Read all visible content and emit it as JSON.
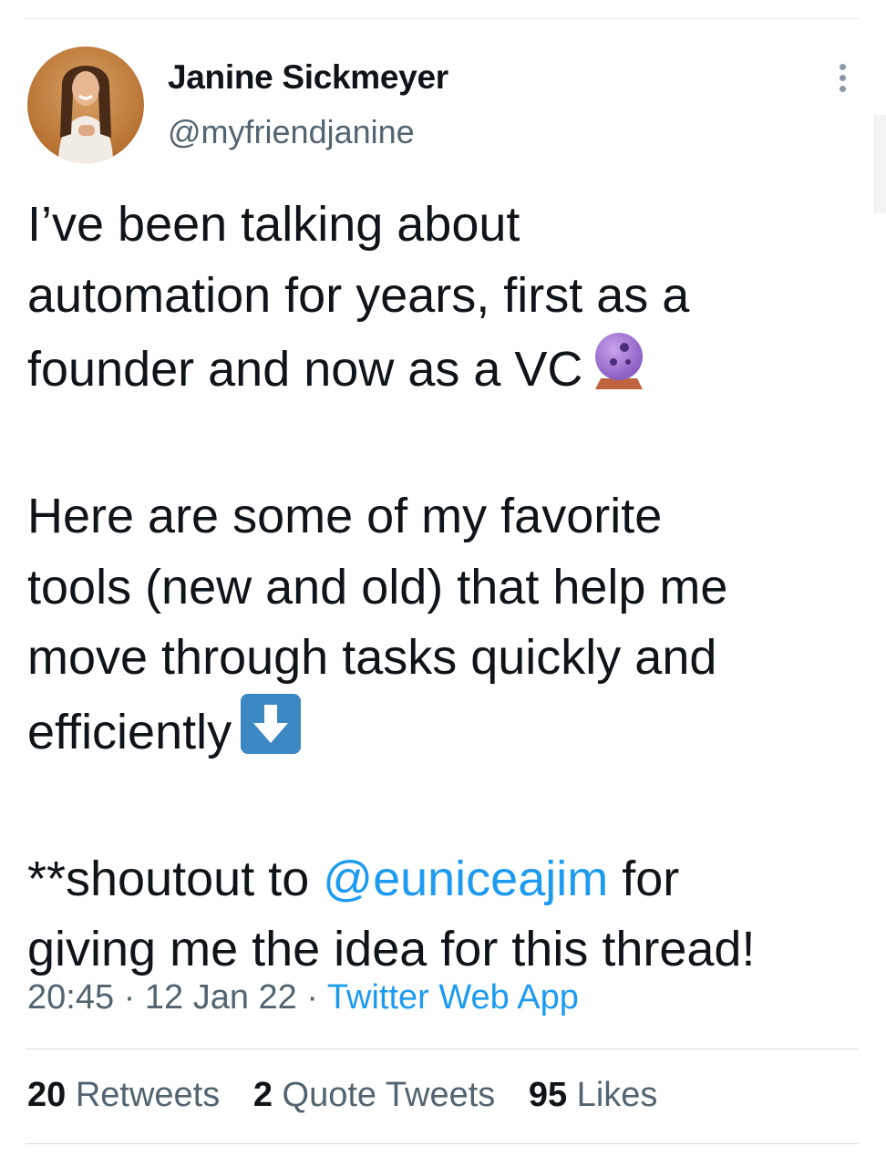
{
  "author": {
    "name": "Janine Sickmeyer",
    "handle": "@myfriendjanine"
  },
  "tweet": {
    "line1": "I’ve been talking about",
    "line2": "automation for years, first as a",
    "line3": "founder and now as a VC",
    "line3_emoji": "crystal-ball-icon",
    "line4": "Here are some of my favorite",
    "line5": "tools (new and old) that help me",
    "line6": "move through tasks quickly and",
    "line7": "efficiently",
    "line7_emoji": "down-arrow-icon",
    "line8_prefix": "**shoutout to ",
    "mention": "@euniceajim",
    "line8_suffix": " for",
    "line9": "giving me the idea for this thread!"
  },
  "meta": {
    "time": "20:45",
    "sep1": " · ",
    "date": "12 Jan 22",
    "sep2": " · ",
    "source": "Twitter Web App"
  },
  "stats": {
    "retweets_count": "20",
    "retweets_label": " Retweets",
    "quotes_count": "2",
    "quotes_label": " Quote Tweets",
    "likes_count": "95",
    "likes_label": " Likes"
  },
  "colors": {
    "accent": "#1d9bf0",
    "secondary_text": "#536471",
    "primary_text": "#0f1419"
  }
}
